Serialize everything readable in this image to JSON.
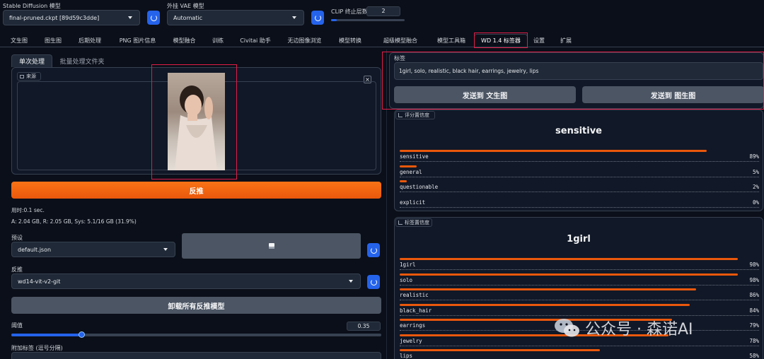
{
  "top": {
    "sd_model_label": "Stable Diffusion 模型",
    "sd_model_value": "final-pruned.ckpt [89d59c3dde]",
    "vae_label": "外挂 VAE 模型",
    "vae_value": "Automatic",
    "clip_label": "CLIP 终止层数",
    "clip_value": "2"
  },
  "tabs": [
    "文生图",
    "图生图",
    "后期处理",
    "PNG 图片信息",
    "模型融合",
    "训练",
    "Civitai 助手",
    "无边图像浏览",
    "模型转换",
    "超级模型融合",
    "模型工具箱",
    "WD 1.4 标签器",
    "设置",
    "扩展"
  ],
  "left": {
    "subtabs": [
      "单次处理",
      "批量处理文件夹"
    ],
    "source_label": "来源",
    "interrogate_button": "反推",
    "time_text": "用时:0.1 sec.",
    "mem_text": "A: 2.04 GB, R: 2.05 GB, Sys: 5.1/16 GB (31.9%)",
    "preset_label": "预设",
    "preset_value": "default.json",
    "interrogator_label": "反推",
    "interrogator_value": "wd14-vit-v2-git",
    "unload_button": "卸载所有反推模型",
    "threshold_label": "阈值",
    "threshold_value": "0.35",
    "threshold_fraction": 0.35,
    "additional_tags_label": "附加标签 (逗号分隔)"
  },
  "right": {
    "tags_label": "标签",
    "tags_value": "1girl, solo, realistic, black hair, earrings, jewelry, lips",
    "send_txt2img": "发送到 文生图",
    "send_img2img": "发送到 图生图",
    "rating_label": "评分置信度",
    "rating_title": "sensitive",
    "ratings": [
      {
        "name": "sensitive",
        "pct": "89%",
        "value": 0.89
      },
      {
        "name": "general",
        "pct": "5%",
        "value": 0.05
      },
      {
        "name": "questionable",
        "pct": "2%",
        "value": 0.02
      },
      {
        "name": "explicit",
        "pct": "0%",
        "value": 0.0
      }
    ],
    "tag_conf_label": "标签置信度",
    "tag_conf_title": "1girl",
    "tag_confs": [
      {
        "name": "1girl",
        "pct": "98%",
        "value": 0.98
      },
      {
        "name": "solo",
        "pct": "98%",
        "value": 0.98
      },
      {
        "name": "realistic",
        "pct": "86%",
        "value": 0.86
      },
      {
        "name": "black_hair",
        "pct": "84%",
        "value": 0.84
      },
      {
        "name": "earrings",
        "pct": "79%",
        "value": 0.79
      },
      {
        "name": "jewelry",
        "pct": "78%",
        "value": 0.78
      },
      {
        "name": "lips",
        "pct": "58%",
        "value": 0.58
      }
    ]
  },
  "watermark": "公众号 · 森诺AI",
  "colors": {
    "accent": "#ea580c",
    "highlight": "#e11d48",
    "refresh": "#2563eb"
  }
}
